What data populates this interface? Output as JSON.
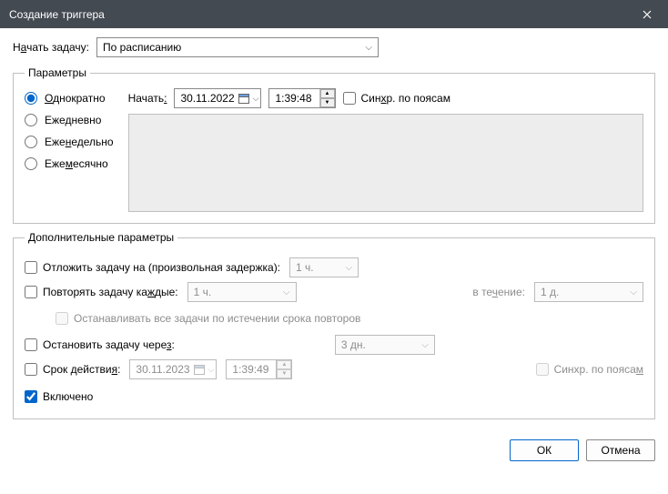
{
  "window": {
    "title": "Создание триггера"
  },
  "beginTask": {
    "label_pre": "Н",
    "label_u": "а",
    "label_post": "чать задачу:",
    "value": "По расписанию"
  },
  "params": {
    "legend": "Параметры",
    "radios": {
      "once": {
        "pre": "",
        "u": "О",
        "post": "днократно"
      },
      "daily": {
        "pre": "Еже",
        "u": "д",
        "post": "невно"
      },
      "weekly": {
        "pre": "Еже",
        "u": "н",
        "post": "едельно"
      },
      "monthly": {
        "pre": "Еже",
        "u": "м",
        "post": "есячно"
      }
    },
    "start": {
      "label_pre": "Начать",
      "label_u": ":",
      "date": "30.11.2022",
      "time": "1:39:48"
    },
    "sync": {
      "pre": "Син",
      "u": "х",
      "post": "р. по поясам"
    }
  },
  "adv": {
    "legend": "Дополнительные параметры",
    "delay": {
      "label": "Отложить задачу на (произвольная задержка):",
      "value": "1 ч."
    },
    "repeat": {
      "label_pre": "Повторять задачу ка",
      "label_u": "ж",
      "label_post": "дые:",
      "value": "1 ч.",
      "for_pre": "в те",
      "for_u": "ч",
      "for_post": "ение:",
      "for_value": "1 д."
    },
    "stop_all": "Останавливать все задачи по истечении срока повторов",
    "stop_after": {
      "label_pre": "Остановить задачу чере",
      "label_u": "з",
      "label_post": ":",
      "value": "3 дн."
    },
    "expire": {
      "label_pre": "Срок действи",
      "label_u": "я",
      "label_post": ":",
      "date": "30.11.2023",
      "time": "1:39:49",
      "sync_pre": "Синхр. по пояса",
      "sync_u": "м",
      "sync_post": ""
    },
    "enabled_label": "Включено"
  },
  "footer": {
    "ok": "ОК",
    "cancel": "Отмена"
  }
}
